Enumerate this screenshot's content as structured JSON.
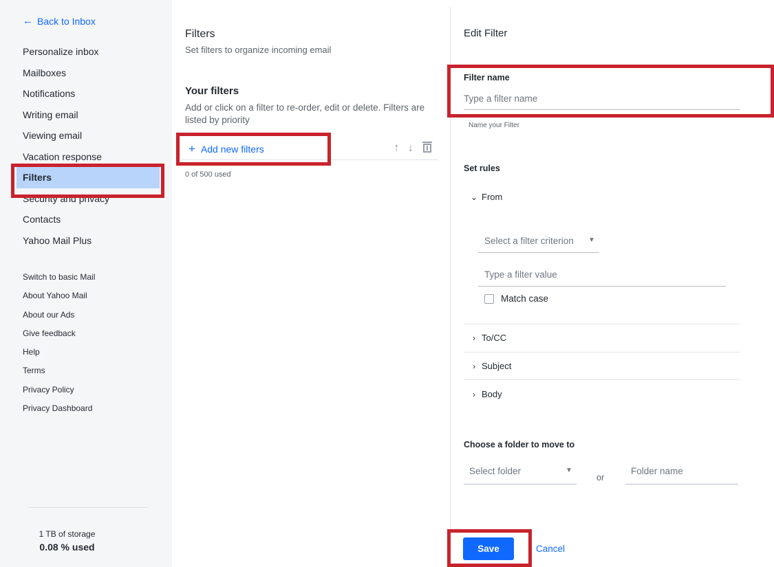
{
  "sidebar": {
    "back_label": "Back to Inbox",
    "items": [
      {
        "label": "Personalize inbox"
      },
      {
        "label": "Mailboxes"
      },
      {
        "label": "Notifications"
      },
      {
        "label": "Writing email"
      },
      {
        "label": "Viewing email"
      },
      {
        "label": "Vacation response"
      },
      {
        "label": "Filters",
        "active": true
      },
      {
        "label": "Security and privacy"
      },
      {
        "label": "Contacts"
      },
      {
        "label": "Yahoo Mail Plus"
      }
    ],
    "secondary": [
      {
        "label": "Switch to basic Mail"
      },
      {
        "label": "About Yahoo Mail"
      },
      {
        "label": "About our Ads"
      },
      {
        "label": "Give feedback"
      },
      {
        "label": "Help"
      },
      {
        "label": "Terms"
      },
      {
        "label": "Privacy Policy"
      },
      {
        "label": "Privacy Dashboard"
      }
    ],
    "storage": {
      "capacity": "1 TB of storage",
      "used": "0.08 % used"
    }
  },
  "filters_panel": {
    "title": "Filters",
    "subtitle": "Set filters to organize incoming email",
    "your_filters_heading": "Your filters",
    "your_filters_desc": "Add or click on a filter to re-order, edit or delete. Filters are listed by priority",
    "add_label": "Add new filters",
    "used_count": "0 of 500 used"
  },
  "edit_filter": {
    "title": "Edit Filter",
    "filter_name_label": "Filter name",
    "filter_name_placeholder": "Type a filter name",
    "filter_name_help": "Name your Filter",
    "set_rules_label": "Set rules",
    "from_label": "From",
    "criterion_placeholder": "Select a filter criterion",
    "value_placeholder": "Type a filter value",
    "match_case_label": "Match case",
    "to_cc_label": "To/CC",
    "subject_label": "Subject",
    "body_label": "Body",
    "folder_heading": "Choose a folder to move to",
    "select_folder_placeholder": "Select folder",
    "or_label": "or",
    "folder_name_placeholder": "Folder name",
    "save_label": "Save",
    "cancel_label": "Cancel"
  },
  "colors": {
    "accent": "#0f69ff",
    "sidebar_bg": "#f5f6f8",
    "active_bg": "#b8d4fb",
    "annotation": "#c8232c"
  },
  "icons": [
    "left-arrow-icon",
    "plus-icon",
    "arrow-up-icon",
    "arrow-down-icon",
    "trash-icon",
    "chevron-down-icon",
    "chevron-right-icon",
    "caret-down-icon"
  ]
}
